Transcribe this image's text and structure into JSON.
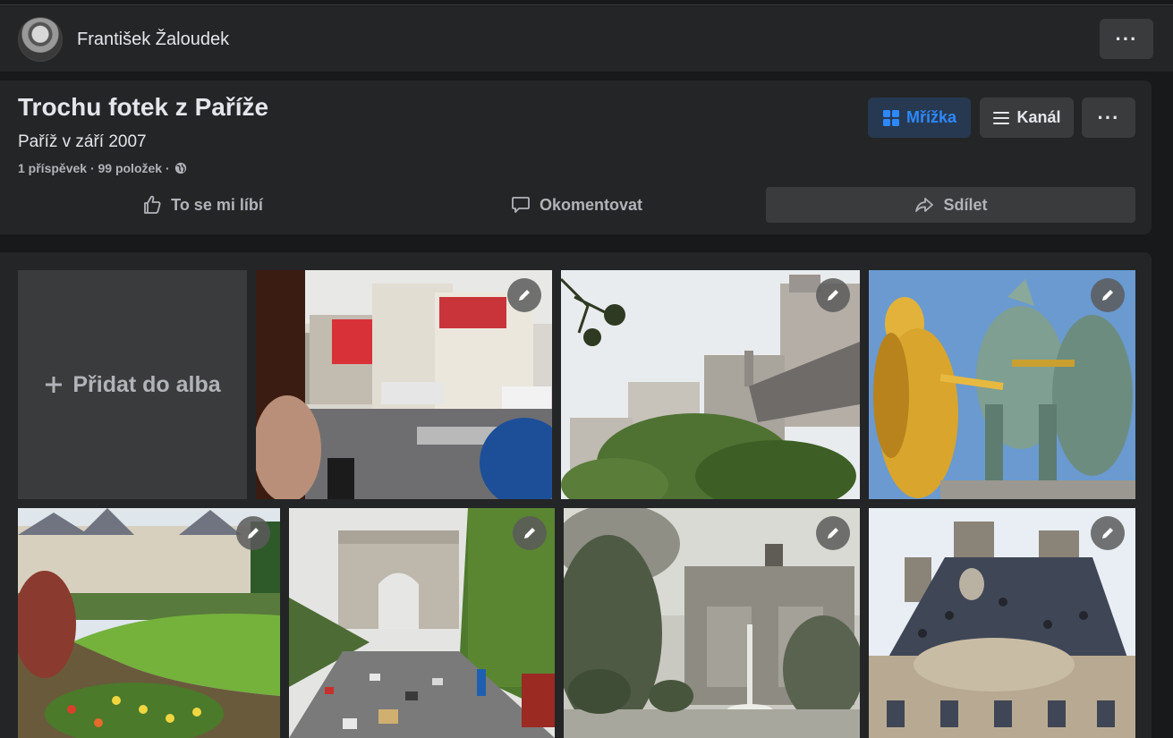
{
  "header": {
    "author_name": "František Žaloudek",
    "more_label": "···"
  },
  "album": {
    "title": "Trochu fotek z Paříže",
    "subtitle": "Paříž v září 2007",
    "meta": "1 příspěvek · 99 položek ·",
    "view_grid_label": "Mřížka",
    "view_feed_label": "Kanál",
    "more_label": "···"
  },
  "actions": {
    "like_label": "To se mi líbí",
    "comment_label": "Okomentovat",
    "share_label": "Sdílet"
  },
  "grid": {
    "add_label": "Přidat do alba",
    "photos": [
      {
        "subject": "Moulin Rouge street"
      },
      {
        "subject": "Paris rooftops with tree"
      },
      {
        "subject": "Golden statue with horses"
      },
      {
        "subject": "Luxembourg palace garden"
      },
      {
        "subject": "Arc de Triomphe avenue"
      },
      {
        "subject": "Arc du Carrousel fountain"
      },
      {
        "subject": "Louvre ornate roof"
      }
    ]
  },
  "colors": {
    "background": "#18191a",
    "surface": "#242526",
    "button": "#3a3b3c",
    "accent": "#2d88ff",
    "accent_bg": "#263951"
  }
}
